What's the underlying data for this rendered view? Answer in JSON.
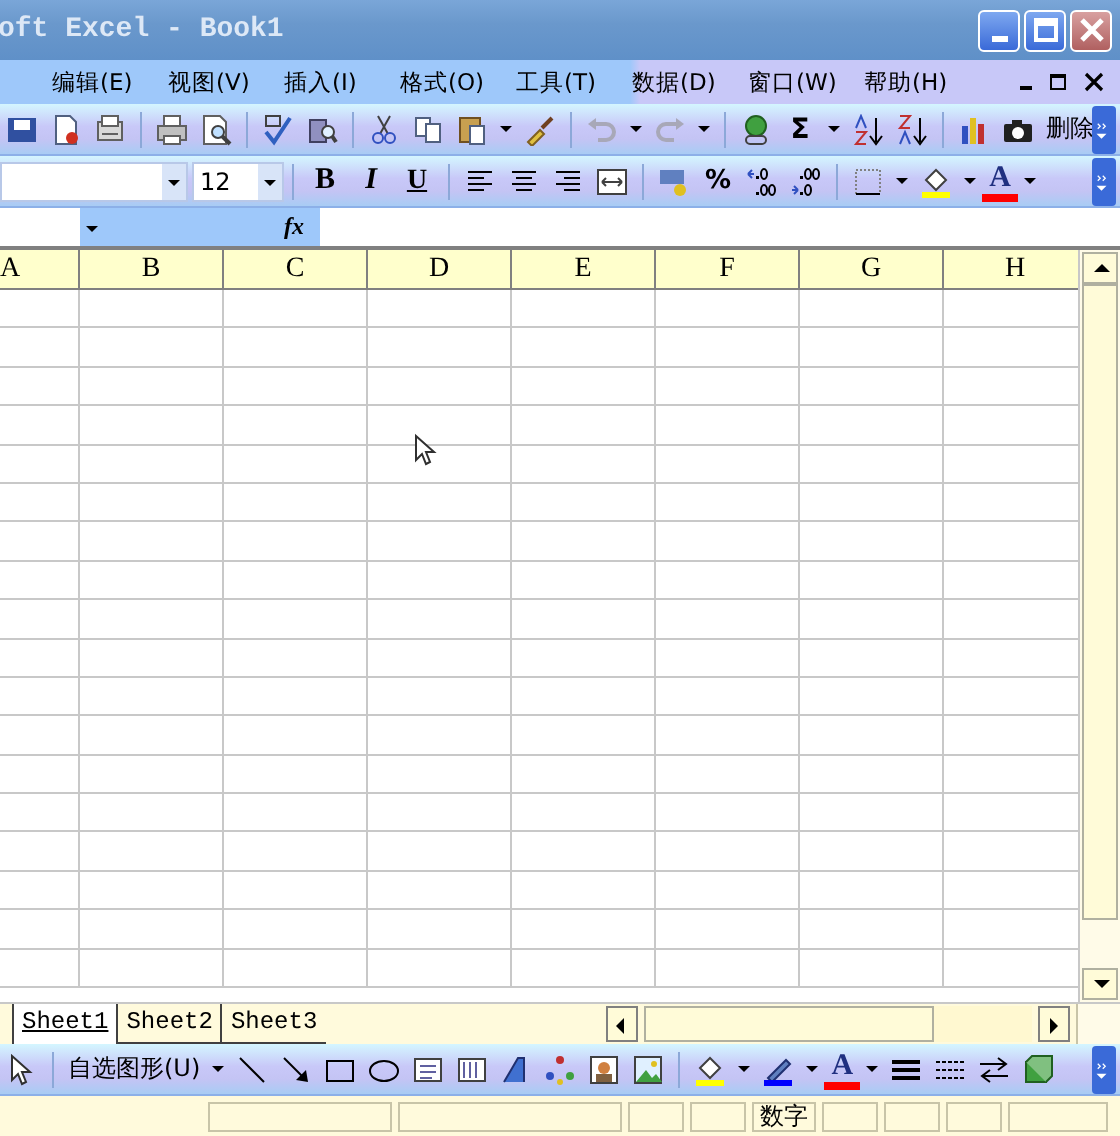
{
  "window": {
    "title": "oft Excel - Book1"
  },
  "menu": [
    "编辑(E)",
    "视图(V)",
    "插入(I)",
    "格式(O)",
    "工具(T)",
    "数据(D)",
    "窗口(W)",
    "帮助(H)"
  ],
  "standard_toolbar": {
    "sum": "Σ",
    "delete": "删除"
  },
  "formatting_toolbar": {
    "font_size": "12",
    "bold": "B",
    "italic": "I",
    "underline": "U",
    "percent": "%",
    "font_color": "A"
  },
  "formula_bar": {
    "fx": "fx"
  },
  "columns": [
    "A",
    "B",
    "C",
    "D",
    "E",
    "F",
    "G",
    "H"
  ],
  "sheet_tabs": [
    {
      "label": "Sheet1",
      "selected": true
    },
    {
      "label": "Sheet2",
      "selected": false
    },
    {
      "label": "Sheet3",
      "selected": false
    }
  ],
  "drawing_toolbar": {
    "autoshapes": "自选图形(U)",
    "font_color": "A"
  },
  "status_bar": {
    "mode": "数字"
  }
}
